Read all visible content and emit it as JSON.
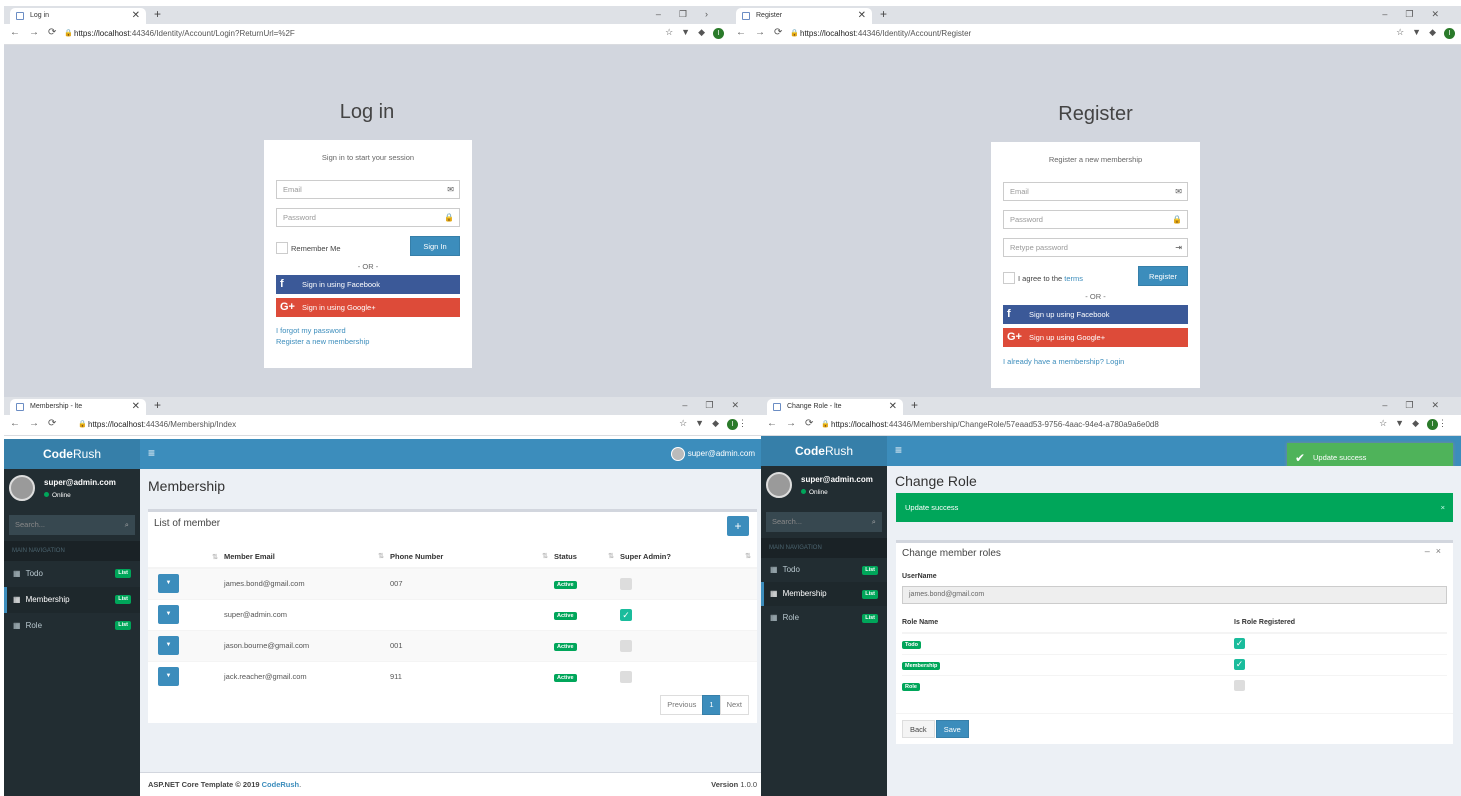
{
  "login": {
    "tab_title": "Log in",
    "url_host": "https://localhost",
    "url_rest": ":44346/Identity/Account/Login?ReturnUrl=%2F",
    "heading": "Log in",
    "msg": "Sign in to start your session",
    "email_ph": "Email",
    "password_ph": "Password",
    "remember": "Remember Me",
    "signin": "Sign In",
    "or": "- OR -",
    "facebook": "Sign in using Facebook",
    "google": "Sign in using Google+",
    "forgot": "I forgot my password",
    "register_link": "Register a new membership"
  },
  "register": {
    "tab_title": "Register",
    "url_host": "https://localhost",
    "url_rest": ":44346/Identity/Account/Register",
    "heading": "Register",
    "msg": "Register a new membership",
    "email_ph": "Email",
    "password_ph": "Password",
    "retype_ph": "Retype password",
    "agree": "I agree to the ",
    "terms": "terms",
    "register_btn": "Register",
    "or": "- OR -",
    "facebook": "Sign up using Facebook",
    "google": "Sign up using Google+",
    "login_link": "I already have a membership? Login"
  },
  "membership": {
    "tab_title": "Membership - lte",
    "url_host": "https://localhost",
    "url_rest": ":44346/Membership/Index",
    "logo_a": "Code",
    "logo_b": "Rush",
    "user": "super@admin.com",
    "online": "Online",
    "search_ph": "Search...",
    "nav_header": "MAIN NAVIGATION",
    "menu": [
      {
        "label": "Todo",
        "badge": "List"
      },
      {
        "label": "Membership",
        "badge": "List"
      },
      {
        "label": "Role",
        "badge": "List"
      }
    ],
    "page_title": "Membership",
    "box_title": "List of member",
    "columns": [
      "Member Email",
      "Phone Number",
      "Status",
      "Super Admin?"
    ],
    "rows": [
      {
        "email": "james.bond@gmail.com",
        "phone": "007",
        "status": "Active",
        "super_admin": false
      },
      {
        "email": "super@admin.com",
        "phone": "",
        "status": "Active",
        "super_admin": true
      },
      {
        "email": "jason.bourne@gmail.com",
        "phone": "001",
        "status": "Active",
        "super_admin": false
      },
      {
        "email": "jack.reacher@gmail.com",
        "phone": "911",
        "status": "Active",
        "super_admin": false
      }
    ],
    "pager": {
      "prev": "Previous",
      "page": "1",
      "next": "Next"
    },
    "footer_left": "ASP.NET Core Template © 2019 ",
    "footer_brand": "CodeRush",
    "footer_version_label": "Version",
    "footer_version": "1.0.0"
  },
  "changerole": {
    "tab_title": "Change Role - lte",
    "url_host": "https://localhost",
    "url_rest": ":44346/Membership/ChangeRole/57eaad53-9756-4aac-94e4-a780a9a6e0d8",
    "toast": "Update success",
    "page_title": "Change Role",
    "alert": "Update success",
    "box_title": "Change member roles",
    "username_label": "UserName",
    "username_value": "james.bond@gmail.com",
    "col_role": "Role Name",
    "col_reg": "Is Role Registered",
    "roles": [
      {
        "name": "Todo",
        "registered": true
      },
      {
        "name": "Membership",
        "registered": true
      },
      {
        "name": "Role",
        "registered": false
      }
    ],
    "back": "Back",
    "save": "Save"
  },
  "colors": {
    "primary": "#3c8dbc",
    "success": "#00a65a",
    "sidebar": "#222d32",
    "facebook": "#3b5998",
    "google": "#dd4b39"
  }
}
